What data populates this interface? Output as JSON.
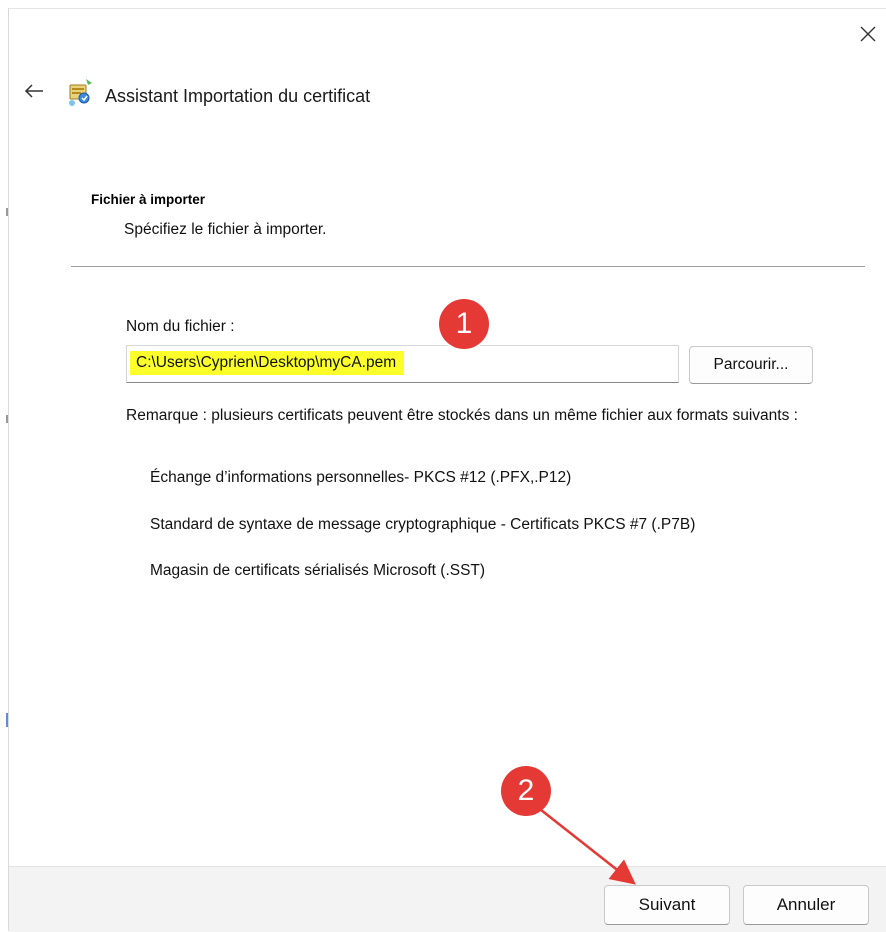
{
  "window": {
    "title": "Assistant Importation du certificat",
    "close_icon": "close-icon",
    "back_icon": "back-arrow-icon",
    "wizard_icon": "certificate-wizard-icon"
  },
  "section": {
    "title": "Fichier à importer",
    "subtitle": "Spécifiez le fichier à importer."
  },
  "file_field": {
    "label": "Nom du fichier :",
    "value": "C:\\Users\\Cyprien\\Desktop\\myCA.pem",
    "highlight_color": "#fcff2a"
  },
  "browse_button": {
    "label": "Parcourir..."
  },
  "remark": {
    "text": "Remarque : plusieurs certificats peuvent être stockés dans un même fichier aux formats suivants :"
  },
  "formats": [
    "Échange d’informations personnelles- PKCS #12 (.PFX,.P12)",
    "Standard de syntaxe de message cryptographique - Certificats PKCS #7 (.P7B)",
    "Magasin de certificats sérialisés Microsoft (.SST)"
  ],
  "annotations": {
    "marker_1": "1",
    "marker_2": "2",
    "marker_color": "#e53935"
  },
  "footer": {
    "next_label": "Suivant",
    "cancel_label": "Annuler"
  }
}
